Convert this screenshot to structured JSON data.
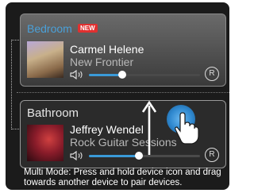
{
  "zones": [
    {
      "room": "Bedroom",
      "badge": "NEW",
      "artist": "Carmel Helene",
      "track": "New Frontier",
      "volume_fraction": 0.3,
      "r_label": "R",
      "speaker_icon": "speaker-icon"
    },
    {
      "room": "Bathroom",
      "artist": "Jeffrey Wendel",
      "track": "Rock Guitar Sessions",
      "volume_fraction": 0.45,
      "r_label": "R",
      "speaker_icon": "speaker-icon"
    }
  ],
  "gesture": {
    "arrow_icon": "up-arrow-icon",
    "hand_icon": "touch-hand-icon"
  },
  "instructions": "Multi Mode: Press and hold device icon and drag towards another device to pair devices.",
  "colors": {
    "accent": "#3a9ad8",
    "badge": "#e03030",
    "background": "#1b1b1b"
  }
}
